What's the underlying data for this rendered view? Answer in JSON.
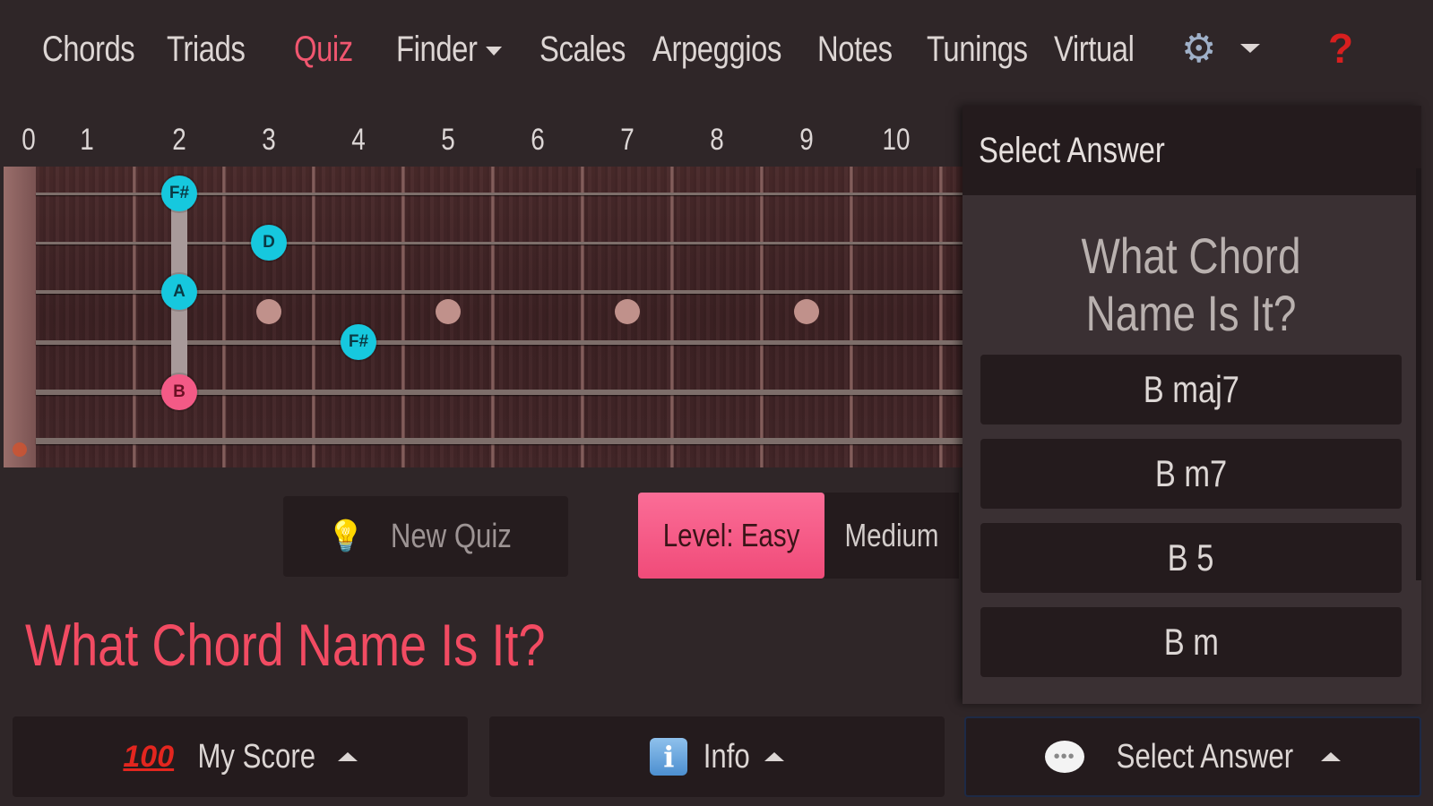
{
  "nav": {
    "items": [
      "Chords",
      "Triads",
      "Quiz",
      "Finder",
      "Scales",
      "Arpeggios",
      "Notes",
      "Tunings",
      "Virtual"
    ],
    "active": "Quiz",
    "settings_icon": "gear-icon",
    "help_label": "?"
  },
  "fretboard": {
    "fret_numbers": [
      "0",
      "1",
      "2",
      "3",
      "4",
      "5",
      "6",
      "7",
      "8",
      "9",
      "10"
    ],
    "notes": [
      {
        "label": "F#",
        "string": 1,
        "fret": 2,
        "role": "tone"
      },
      {
        "label": "D",
        "string": 2,
        "fret": 3,
        "role": "tone"
      },
      {
        "label": "A",
        "string": 3,
        "fret": 2,
        "role": "tone"
      },
      {
        "label": "F#",
        "string": 4,
        "fret": 4,
        "role": "tone"
      },
      {
        "label": "B",
        "string": 5,
        "fret": 2,
        "role": "root"
      }
    ],
    "inlay_frets": [
      3,
      5,
      7,
      9
    ]
  },
  "controls": {
    "new_quiz": "New Quiz",
    "level_easy": "Level: Easy",
    "level_medium": "Medium"
  },
  "question": "What Chord Name Is It?",
  "panel": {
    "title": "Select Answer",
    "question": "What Chord Name Is It?",
    "answers": [
      "B maj7",
      "B m7",
      "B 5",
      "B m"
    ]
  },
  "bottom": {
    "score": "My Score",
    "info": "Info",
    "select": "Select Answer",
    "info_icon_glyph": "i"
  },
  "colors": {
    "accent": "#f0566f",
    "note_tone": "#16c8de",
    "note_root": "#f35a86",
    "level_active": "#f04b79"
  }
}
